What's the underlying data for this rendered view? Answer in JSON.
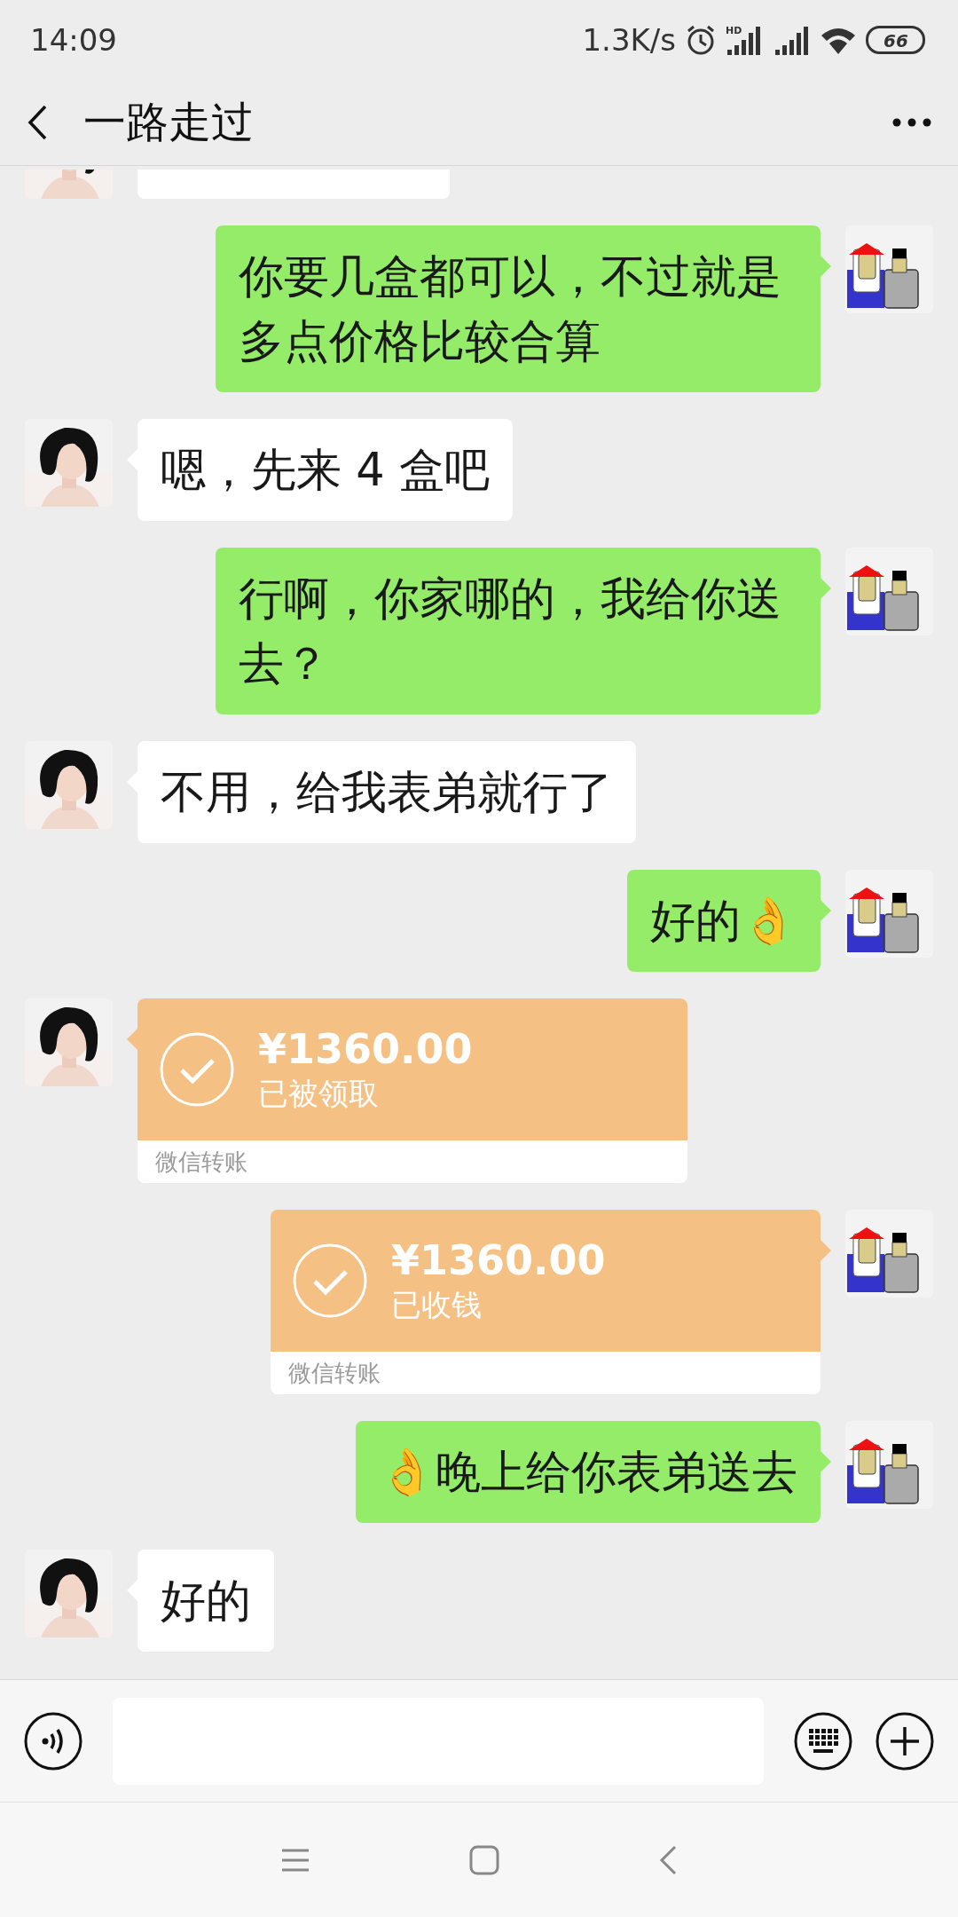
{
  "status_bar": {
    "time": "14:09",
    "net_speed": "1.3K/s",
    "hd_label": "HD",
    "battery": "66"
  },
  "header": {
    "title": "一路走过"
  },
  "messages": [
    {
      "kind": "cut",
      "sent": false
    },
    {
      "kind": "text",
      "sent": true,
      "text": "你要几盒都可以，不过就是多点价格比较合算"
    },
    {
      "kind": "text",
      "sent": false,
      "text": "嗯，先来 4 盒吧"
    },
    {
      "kind": "text",
      "sent": true,
      "text": "行啊，你家哪的，我给你送去？"
    },
    {
      "kind": "text",
      "sent": false,
      "text": "不用，给我表弟就行了"
    },
    {
      "kind": "text",
      "sent": true,
      "text": "好的👌"
    },
    {
      "kind": "transfer",
      "sent": false,
      "amount": "¥1360.00",
      "status": "已被领取",
      "footer": "微信转账"
    },
    {
      "kind": "transfer",
      "sent": true,
      "amount": "¥1360.00",
      "status": "已收钱",
      "footer": "微信转账"
    },
    {
      "kind": "text",
      "sent": true,
      "text": "👌晚上给你表弟送去"
    },
    {
      "kind": "text",
      "sent": false,
      "text": "好的"
    }
  ]
}
